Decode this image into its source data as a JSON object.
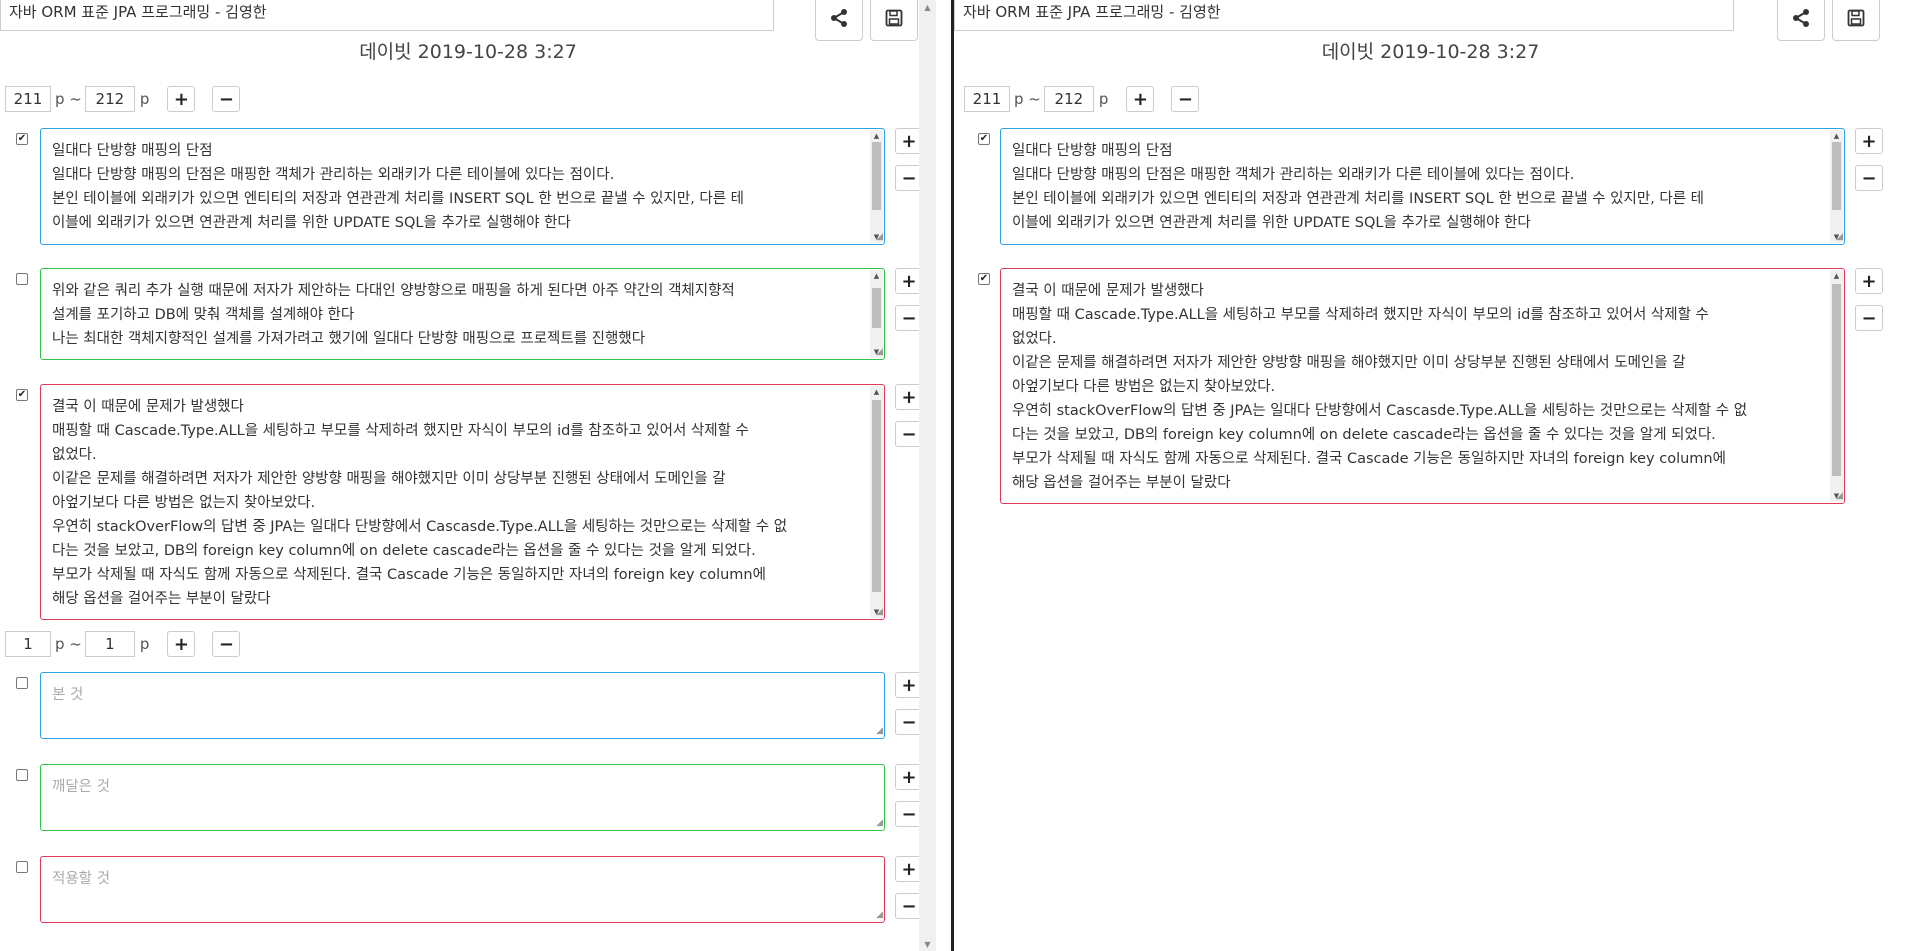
{
  "window": {
    "title": "자바 ORM 표준 JPA 프로그래밍 - 김영한",
    "subtitle": "데이빗 2019-10-28 3:27",
    "share_icon": "share-icon",
    "save_icon": "save-icon"
  },
  "left": {
    "range1": {
      "from": "211",
      "to": "212",
      "p": "p",
      "tilde": "p ~"
    },
    "notes": [
      {
        "checked": true,
        "color": "#2ea1e8",
        "lines": [
          "일대다 단방향 매핑의 단점",
          "일대다 단방향 매핑의 단점은 매핑한 객체가 관리하는 외래키가 다른 테이블에 있다는 점이다.",
          "본인 테이블에 외래키가 있으면 엔티티의 저장과 연관관계 처리를 INSERT SQL 한 번으로 끝낼 수 있지만, 다른 테",
          "이블에 외래키가 있으면 연관관계 처리를 위한 UPDATE SQL을 추가로 실행해야 한다"
        ]
      },
      {
        "checked": false,
        "color": "#33c148",
        "lines": [
          "위와 같은 쿼리 추가 실행 때문에 저자가 제안하는 다대인 양방향으로 매핑을 하게 된다면 아주 약간의 객체지향적",
          "설계를 포기하고 DB에 맞춰 객체를 설계해야 한다",
          "나는 최대한 객체지향적인 설계를 가져가려고 했기에 일대다 단방향 매핑으로 프로젝트를 진행했다"
        ]
      },
      {
        "checked": true,
        "color": "#e03a5a",
        "lines": [
          "결국 이 때문에 문제가 발생했다",
          "매핑할 때 Cascade.Type.ALL을 세팅하고 부모를 삭제하려 했지만 자식이 부모의 id를 참조하고 있어서 삭제할 수",
          "없었다.",
          "이같은 문제를 해결하려면 저자가 제안한 양방향 매핑을 해야했지만 이미 상당부분 진행된 상태에서 도메인을 갈",
          "아엎기보다 다른 방법은 없는지 찾아보았다.",
          "우연히 stackOverFlow의 답변 중 JPA는 일대다 단방향에서 Cascasde.Type.ALL을 세팅하는 것만으로는 삭제할 수 없",
          "다는 것을 보았고, DB의 foreign key column에 on delete cascade라는 옵션을 줄 수 있다는 것을 알게 되었다.",
          "부모가 삭제될 때 자식도 함께 자동으로 삭제된다. 결국 Cascade 기능은 동일하지만 자녀의 foreign key column에",
          "해당 옵션을 걸어주는 부분이 달랐다"
        ]
      }
    ],
    "range2": {
      "from": "1",
      "to": "1",
      "p": "p",
      "tilde": "p ~"
    },
    "reflection": [
      {
        "checked": false,
        "placeholder": "본 것"
      },
      {
        "checked": false,
        "placeholder": "깨달은 것"
      },
      {
        "checked": false,
        "placeholder": "적용할 것"
      }
    ]
  },
  "right": {
    "range1": {
      "from": "211",
      "to": "212",
      "p": "p",
      "tilde": "p ~"
    },
    "notes": [
      {
        "checked": true,
        "color": "#2ea1e8",
        "lines": [
          "일대다 단방향 매핑의 단점",
          "일대다 단방향 매핑의 단점은 매핑한 객체가 관리하는 외래키가 다른 테이블에 있다는 점이다.",
          "본인 테이블에 외래키가 있으면 엔티티의 저장과 연관관계 처리를 INSERT SQL 한 번으로 끝낼 수 있지만, 다른 테",
          "이블에 외래키가 있으면 연관관계 처리를 위한 UPDATE SQL을 추가로 실행해야 한다"
        ]
      },
      {
        "checked": true,
        "color": "#e03a5a",
        "lines": [
          "결국 이 때문에 문제가 발생했다",
          "매핑할 때 Cascade.Type.ALL을 세팅하고 부모를 삭제하려 했지만 자식이 부모의 id를 참조하고 있어서 삭제할 수",
          "없었다.",
          "이같은 문제를 해결하려면 저자가 제안한 양방향 매핑을 해야했지만 이미 상당부분 진행된 상태에서 도메인을 갈",
          "아엎기보다 다른 방법은 없는지 찾아보았다.",
          "우연히 stackOverFlow의 답변 중 JPA는 일대다 단방향에서 Cascasde.Type.ALL을 세팅하는 것만으로는 삭제할 수 없",
          "다는 것을 보았고, DB의 foreign key column에 on delete cascade라는 옵션을 줄 수 있다는 것을 알게 되었다.",
          "부모가 삭제될 때 자식도 함께 자동으로 삭제된다. 결국 Cascade 기능은 동일하지만 자녀의 foreign key column에",
          "해당 옵션을 걸어주는 부분이 달랐다"
        ]
      }
    ]
  },
  "buttons": {
    "plus": "+",
    "minus": "−"
  }
}
